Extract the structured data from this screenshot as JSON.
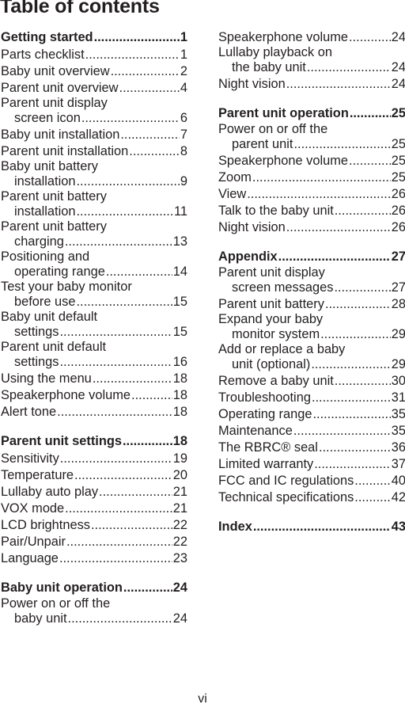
{
  "title": "Table of contents",
  "footer_page": "vi",
  "left": [
    {
      "type": "heading",
      "text": "Getting started",
      "page": "1"
    },
    {
      "type": "entry",
      "text": "Parts checklist",
      "page": "1"
    },
    {
      "type": "entry",
      "text": "Baby unit overview",
      "page": "2"
    },
    {
      "type": "entry",
      "text": "Parent unit overview",
      "page": "4"
    },
    {
      "type": "multi",
      "line1": "Parent unit display",
      "text": "screen icon",
      "page": "6"
    },
    {
      "type": "entry",
      "text": "Baby unit installation",
      "page": "7"
    },
    {
      "type": "entry",
      "text": "Parent unit installation",
      "page": "8"
    },
    {
      "type": "multi",
      "line1": "Baby unit battery",
      "text": "installation",
      "page": "9"
    },
    {
      "type": "multi",
      "line1": "Parent unit battery",
      "text": "installation",
      "page": "11"
    },
    {
      "type": "multi",
      "line1": "Parent unit battery",
      "text": "charging",
      "page": "13"
    },
    {
      "type": "multi",
      "line1": "Positioning and",
      "text": "operating range",
      "page": "14"
    },
    {
      "type": "multi",
      "line1": "Test your baby monitor",
      "text": "before use",
      "page": "15"
    },
    {
      "type": "multi",
      "line1": "Baby unit default",
      "text": "settings",
      "page": "15"
    },
    {
      "type": "multi",
      "line1": "Parent unit default",
      "text": "settings",
      "page": "16"
    },
    {
      "type": "entry",
      "text": "Using the menu",
      "page": "18"
    },
    {
      "type": "entry",
      "text": "Speakerphone volume",
      "page": "18"
    },
    {
      "type": "entry",
      "text": "Alert tone",
      "page": "18"
    },
    {
      "type": "heading",
      "text": "Parent unit settings",
      "page": "18",
      "gap": true
    },
    {
      "type": "entry",
      "text": "Sensitivity",
      "page": "19"
    },
    {
      "type": "entry",
      "text": "Temperature",
      "page": "20"
    },
    {
      "type": "entry",
      "text": "Lullaby auto play",
      "page": "21"
    },
    {
      "type": "entry",
      "text": "VOX mode",
      "page": "21"
    },
    {
      "type": "entry",
      "text": "LCD brightness",
      "page": "22"
    },
    {
      "type": "entry",
      "text": "Pair/Unpair",
      "page": "22"
    },
    {
      "type": "entry",
      "text": "Language",
      "page": "23"
    },
    {
      "type": "heading",
      "text": "Baby unit operation",
      "page": "24",
      "gap": true
    },
    {
      "type": "multi",
      "line1": "Power on or off the",
      "text": "baby unit",
      "page": "24"
    }
  ],
  "right": [
    {
      "type": "entry",
      "text": "Speakerphone volume",
      "page": "24"
    },
    {
      "type": "multi",
      "line1": "Lullaby playback on",
      "text": "the baby unit",
      "page": "24"
    },
    {
      "type": "entry",
      "text": "Night vision",
      "page": "24"
    },
    {
      "type": "heading",
      "text": "Parent unit operation",
      "page": "25",
      "gap": true
    },
    {
      "type": "multi",
      "line1": "Power on or off the",
      "text": "parent unit",
      "page": "25"
    },
    {
      "type": "entry",
      "text": "Speakerphone volume",
      "page": "25"
    },
    {
      "type": "entry",
      "text": "Zoom",
      "page": "25"
    },
    {
      "type": "entry",
      "text": "View",
      "page": "26"
    },
    {
      "type": "entry",
      "text": "Talk to the baby unit",
      "page": "26"
    },
    {
      "type": "entry",
      "text": "Night vision",
      "page": "26"
    },
    {
      "type": "heading",
      "text": "Appendix",
      "page": "27",
      "gap": true
    },
    {
      "type": "multi",
      "line1": "Parent unit display",
      "text": "screen messages",
      "page": "27"
    },
    {
      "type": "entry",
      "text": "Parent unit battery",
      "page": "28"
    },
    {
      "type": "multi",
      "line1": "Expand your baby",
      "text": "monitor system",
      "page": "29"
    },
    {
      "type": "multi",
      "line1": "Add or replace a baby",
      "text": "unit (optional)",
      "page": "29"
    },
    {
      "type": "entry",
      "text": "Remove a baby unit",
      "page": "30"
    },
    {
      "type": "entry",
      "text": "Troubleshooting",
      "page": "31"
    },
    {
      "type": "entry",
      "text": "Operating range",
      "page": "35"
    },
    {
      "type": "entry",
      "text": "Maintenance",
      "page": "35"
    },
    {
      "type": "entry",
      "text": "The RBRC® seal",
      "page": "36"
    },
    {
      "type": "entry",
      "text": "Limited warranty",
      "page": "37"
    },
    {
      "type": "entry",
      "text": "FCC and IC regulations",
      "page": "40"
    },
    {
      "type": "entry",
      "text": "Technical specifications",
      "page": "42"
    },
    {
      "type": "heading",
      "text": "Index",
      "page": "43",
      "gap": true
    }
  ]
}
